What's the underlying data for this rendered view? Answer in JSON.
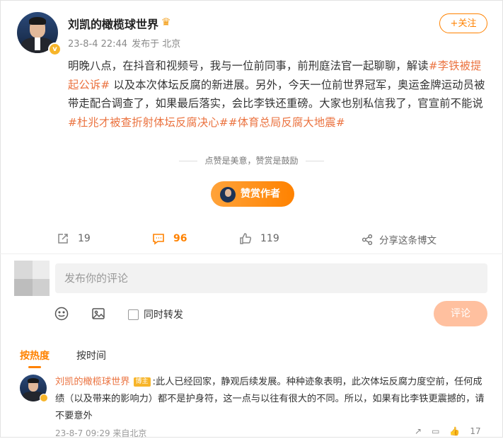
{
  "post": {
    "author": "刘凯的橄榄球世界",
    "time": "23-8-4 22:44",
    "location": "发布于 北京",
    "follow_label": "+关注",
    "text_1": "明晚八点，在抖音和视频号，我与一位前同事，前刑庭法官一起聊聊，解读",
    "tag_1": "#李铁被提起公诉#",
    "text_2": " 以及本次体坛反腐的新进展。另外，今天一位前世界冠军，奥运金牌运动员被带走配合调查了，如果最后落实，会比李铁还重磅。大家也别私信我了，官宣前不能说 ",
    "tag_2": "#杜兆才被查折射体坛反腐决心#",
    "tag_3": "#体育总局反腐大地震#",
    "reward_hint": "点赞是美意，赞赏是鼓励",
    "reward_button": "赞赏作者"
  },
  "actions": {
    "repost_count": "19",
    "comment_count": "96",
    "like_count": "119",
    "share_label": "分享这条博文"
  },
  "composer": {
    "placeholder": "发布你的评论",
    "repost_label": "同时转发",
    "submit_label": "评论"
  },
  "sort": {
    "hot": "按热度",
    "time": "按时间"
  },
  "comment": {
    "author": "刘凯的橄榄球世界",
    "badge": "博主",
    "text": ":此人已经回家，静观后续发展。种种迹象表明，此次体坛反腐力度空前，任何成绩（以及带来的影响力）都不是护身符，这一点与以往有很大的不同。所以，如果有比李铁更震撼的，请不要意外",
    "meta": "23-8-7 09:29 来自北京",
    "like_count": "17"
  },
  "colors": {
    "accent": "#ff8200",
    "topic": "#eb7340"
  }
}
